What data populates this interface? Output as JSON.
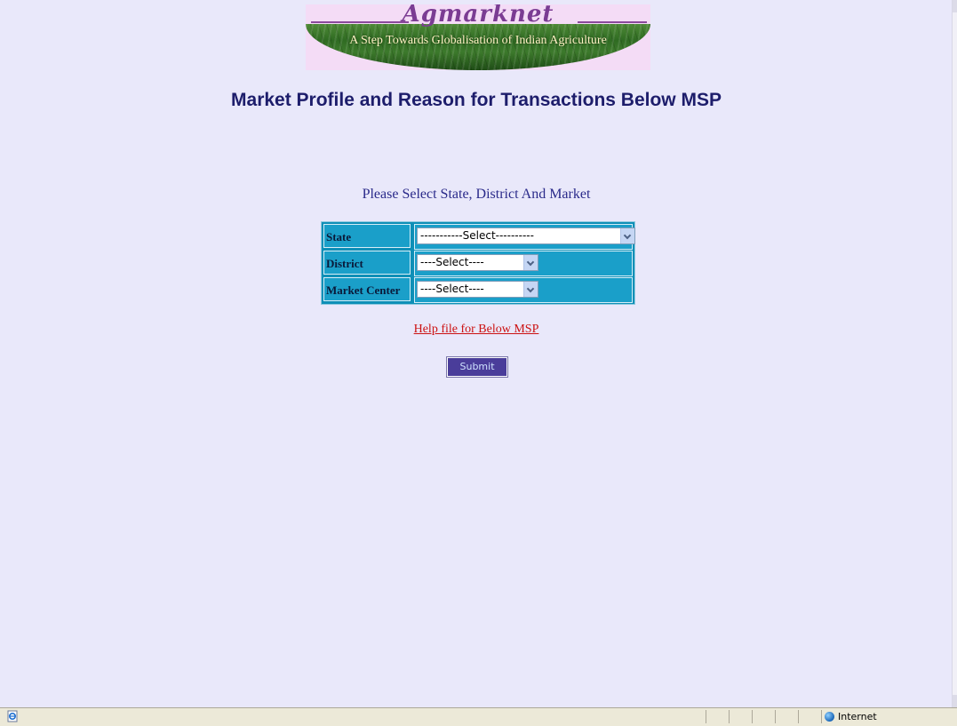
{
  "banner": {
    "logo_text": "Agmarknet",
    "tagline": "A Step Towards Globalisation of Indian Agriculture"
  },
  "page": {
    "title": "Market Profile and Reason for Transactions Below MSP",
    "instruction": "Please Select State, District And Market"
  },
  "form": {
    "rows": [
      {
        "label": "State",
        "selected": "-----------Select----------"
      },
      {
        "label": "District",
        "selected": "----Select----"
      },
      {
        "label": "Market Center",
        "selected": "----Select----"
      }
    ],
    "help_link": "Help file for Below MSP",
    "submit_label": "Submit"
  },
  "statusbar": {
    "zone": "Internet",
    "icons": [
      "ie-page-icon",
      "globe-icon"
    ]
  },
  "colors": {
    "page_bg": "#e9e8fa",
    "title": "#1d1d6b",
    "table_bg": "#1a9fc9",
    "link": "#cc1111",
    "button_bg": "#4a3d9a"
  }
}
